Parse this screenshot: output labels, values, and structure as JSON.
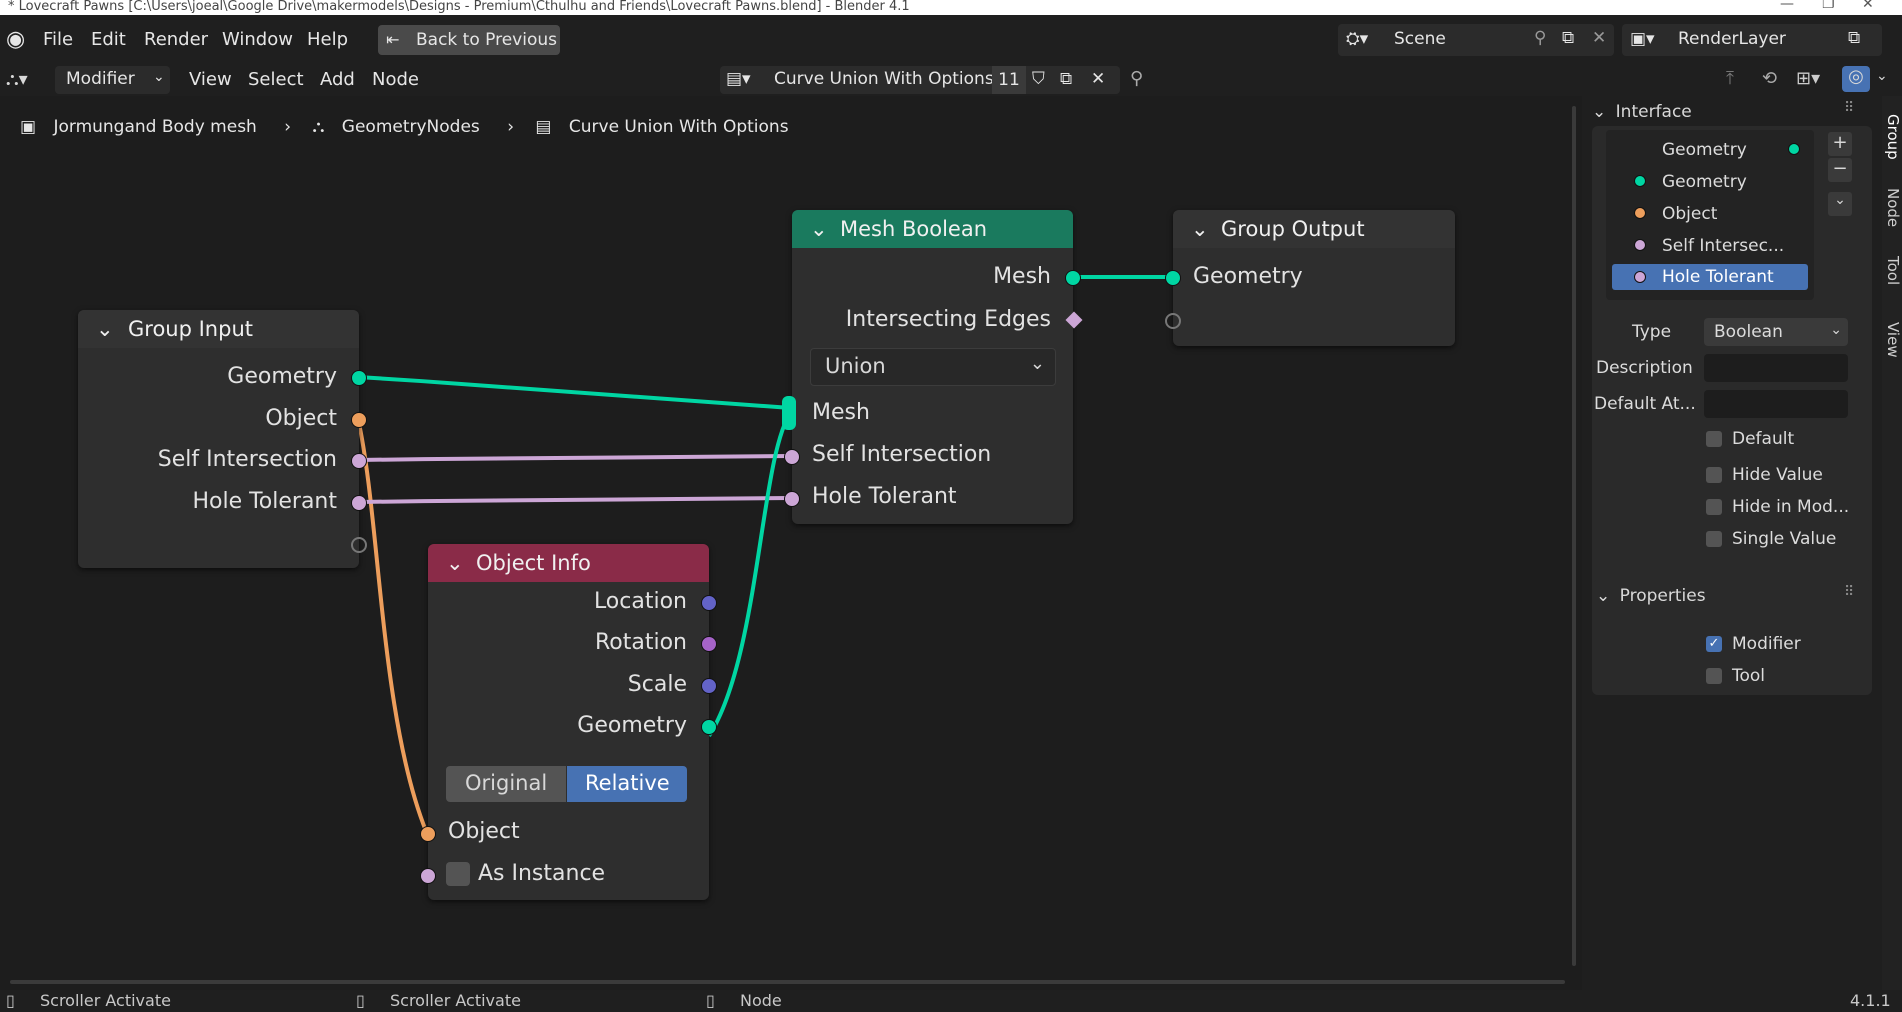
{
  "window": {
    "title": "* Lovecraft Pawns [C:\\Users\\joeal\\Google Drive\\makermodels\\Designs - Premium\\Cthulhu and Friends\\Lovecraft Pawns.blend] - Blender 4.1"
  },
  "menu": {
    "items": [
      "File",
      "Edit",
      "Render",
      "Window",
      "Help"
    ],
    "back_button": "Back to Previous",
    "scene": "Scene",
    "render_layer": "RenderLayer"
  },
  "header": {
    "editor_mode": "Modifier",
    "menus": [
      "View",
      "Select",
      "Add",
      "Node"
    ],
    "node_tree_name": "Curve Union With Options",
    "user_count": "11"
  },
  "breadcrumb": [
    "Jormungand Body mesh",
    "GeometryNodes",
    "Curve Union With Options"
  ],
  "nodes": {
    "group_input": {
      "title": "Group Input",
      "outputs": [
        "Geometry",
        "Object",
        "Self Intersection",
        "Hole Tolerant"
      ]
    },
    "mesh_boolean": {
      "title": "Mesh Boolean",
      "outputs": [
        "Mesh",
        "Intersecting Edges"
      ],
      "operation": "Union",
      "inputs": [
        "Mesh",
        "Self Intersection",
        "Hole Tolerant"
      ]
    },
    "group_output": {
      "title": "Group Output",
      "inputs": [
        "Geometry"
      ]
    },
    "object_info": {
      "title": "Object Info",
      "outputs": [
        "Location",
        "Rotation",
        "Scale",
        "Geometry"
      ],
      "transform_options": [
        "Original",
        "Relative"
      ],
      "selected_transform": "Relative",
      "inputs": [
        "Object",
        "As Instance"
      ]
    }
  },
  "sidebar": {
    "interface_title": "Interface",
    "interface_items": [
      "Geometry",
      "Geometry",
      "Object",
      "Self Intersec...",
      "Hole Tolerant"
    ],
    "selected_item": "Hole Tolerant",
    "type_label": "Type",
    "type_value": "Boolean",
    "description_label": "Description",
    "default_attr_label": "Default At...",
    "checkboxes": [
      "Default",
      "Hide Value",
      "Hide in Mod...",
      "Single Value"
    ],
    "properties_title": "Properties",
    "properties": [
      {
        "label": "Modifier",
        "checked": true
      },
      {
        "label": "Tool",
        "checked": false
      }
    ],
    "tabs": [
      "Group",
      "Node",
      "Tool",
      "View"
    ]
  },
  "status": {
    "left1": "Scroller Activate",
    "left2": "Scroller Activate",
    "left3": "Node",
    "version": "4.1.1"
  },
  "colors": {
    "geometry_socket": "#00d6a3",
    "object_socket": "#ed9e5c",
    "boolean_socket": "#cca6d6",
    "vector_socket": "#6363c7",
    "rotation_socket": "#a563c7",
    "mesh_boolean_header": "#1a7a5e",
    "object_info_header": "#8a2b48",
    "accent": "#4772b3"
  }
}
